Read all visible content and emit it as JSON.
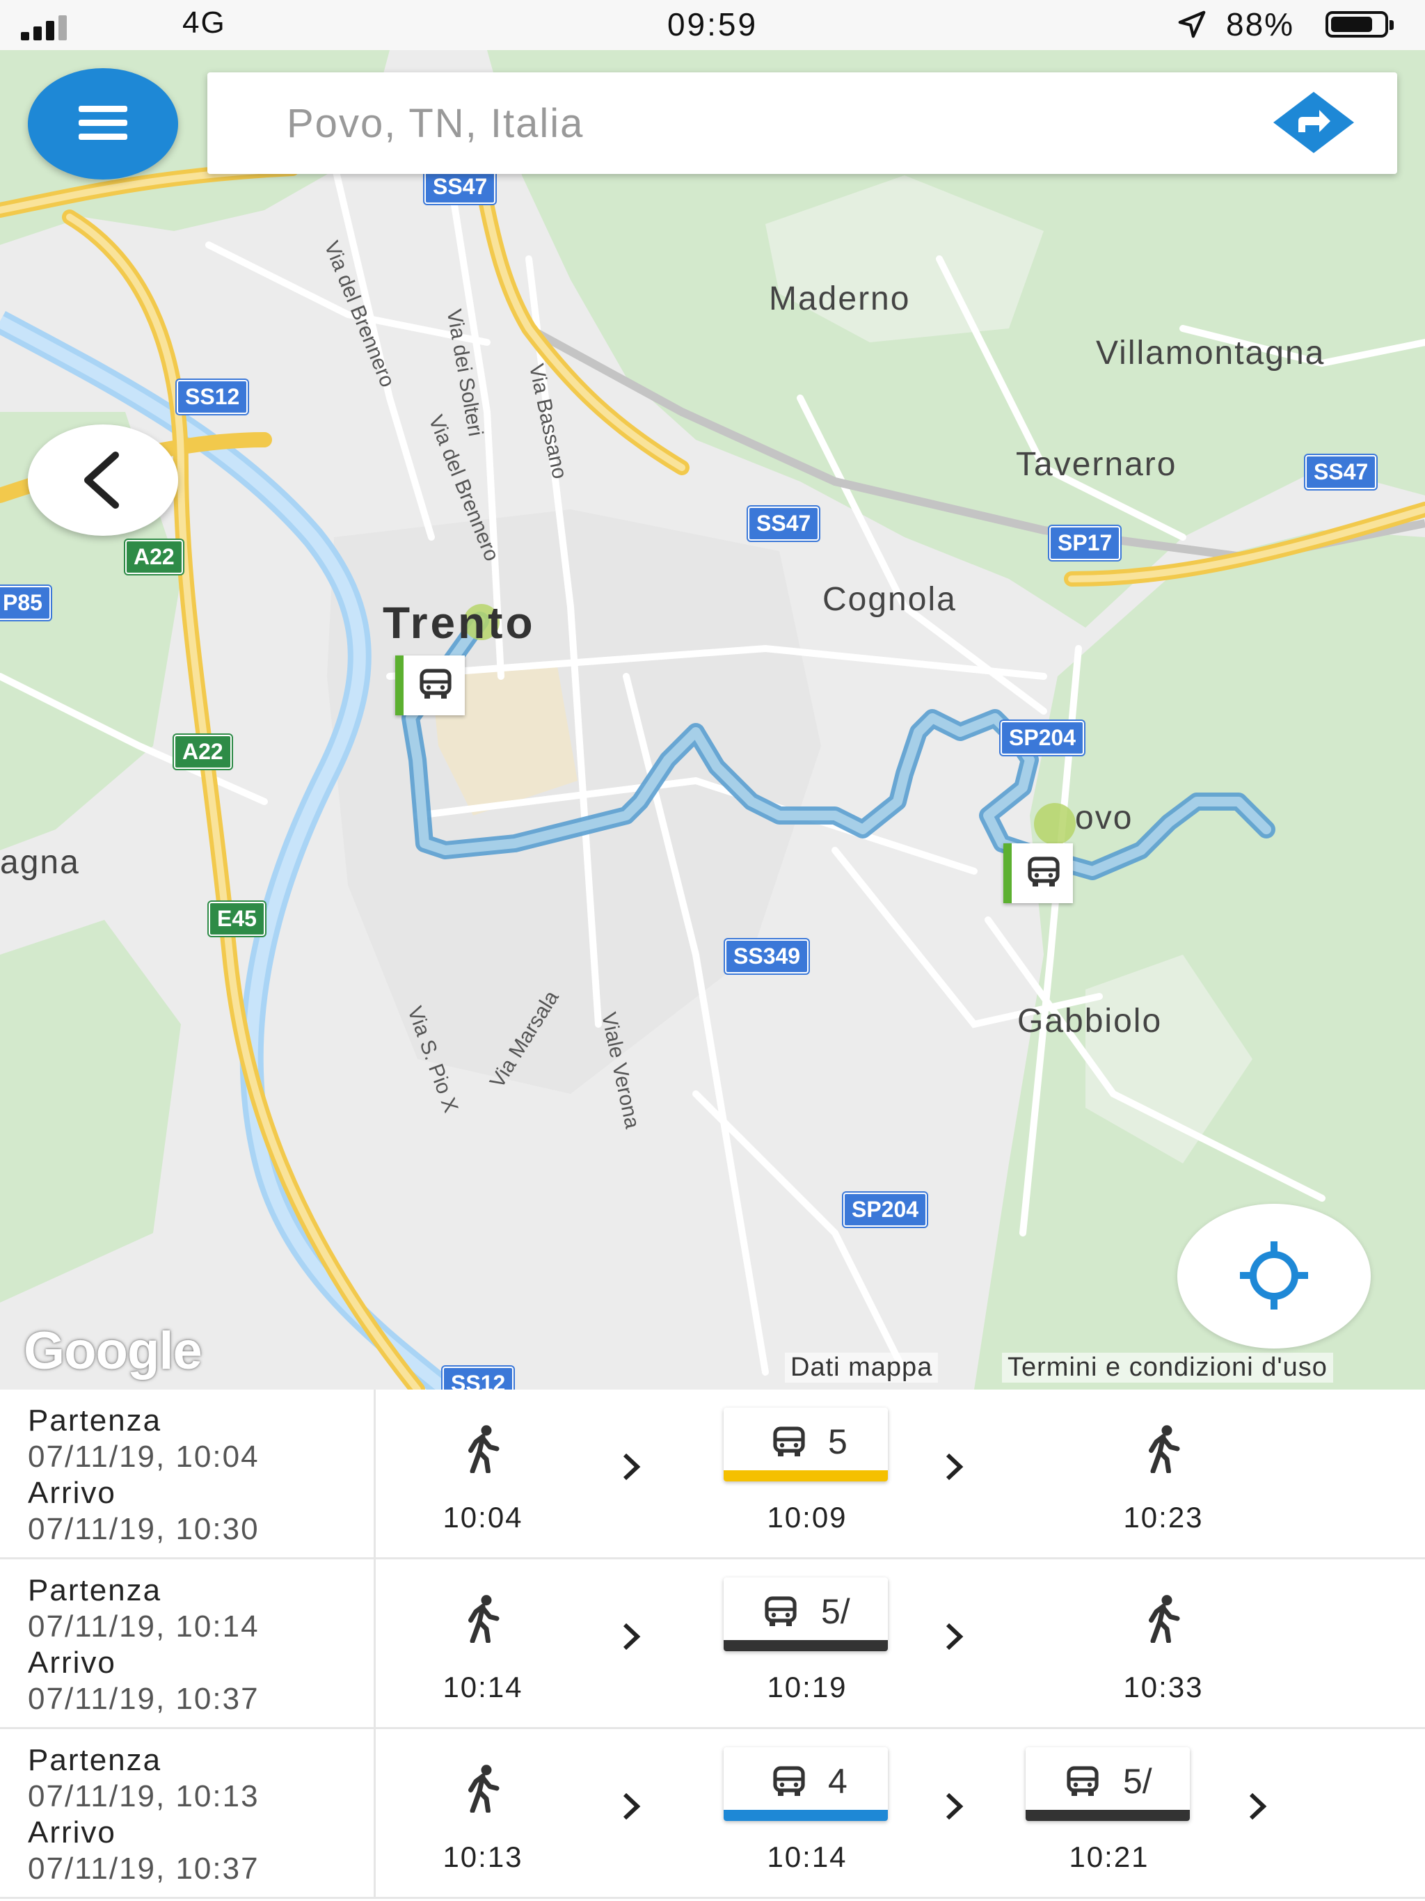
{
  "status_bar": {
    "network": "4G",
    "time": "09:59",
    "battery": "88%"
  },
  "search": {
    "placeholder": "Povo, TN, Italia"
  },
  "map": {
    "places": [
      "Maderno",
      "Villamontagna",
      "Tavernaro",
      "Trento",
      "Cognola",
      "ovo",
      "agna",
      "Gabbiolo"
    ],
    "streets": [
      "Via del Brennero",
      "Via dei Solteri",
      "Via Bassano",
      "Via del Brennero",
      "Via S. Pio X",
      "Via Marsala",
      "Viale Verona"
    ],
    "shields": [
      "SS47",
      "SS12",
      "SS47",
      "SS47",
      "SP17",
      "P85",
      "SP204",
      "SS349",
      "SP204",
      "SS12",
      "A22",
      "A22",
      "E45"
    ],
    "google_logo": "Google",
    "attribution_data": "Dati mappa",
    "attribution_terms": "Termini e condizioni d'uso"
  },
  "itineraries": [
    {
      "departure_label": "Partenza",
      "departure": "07/11/19, 10:04",
      "arrival_label": "Arrivo",
      "arrival": "07/11/19, 10:30",
      "steps": [
        {
          "mode": "walk",
          "time": "10:04"
        },
        {
          "mode": "bus",
          "line": "5",
          "time": "10:09",
          "color": "#f5c000"
        },
        {
          "mode": "walk",
          "time": "10:23"
        }
      ]
    },
    {
      "departure_label": "Partenza",
      "departure": "07/11/19, 10:14",
      "arrival_label": "Arrivo",
      "arrival": "07/11/19, 10:37",
      "steps": [
        {
          "mode": "walk",
          "time": "10:14"
        },
        {
          "mode": "bus",
          "line": "5/",
          "time": "10:19",
          "color": "#333333"
        },
        {
          "mode": "walk",
          "time": "10:33"
        }
      ]
    },
    {
      "departure_label": "Partenza",
      "departure": "07/11/19, 10:13",
      "arrival_label": "Arrivo",
      "arrival": "07/11/19, 10:37",
      "steps": [
        {
          "mode": "walk",
          "time": "10:13"
        },
        {
          "mode": "bus",
          "line": "4",
          "time": "10:14",
          "color": "#1e88d6"
        },
        {
          "mode": "bus",
          "line": "5/",
          "time": "10:21",
          "color": "#333333"
        }
      ]
    }
  ],
  "colors": {
    "accent": "#1e88d6",
    "route": "#8fbfe0",
    "park": "#cfe8c8",
    "highway": "#f6d36b"
  }
}
